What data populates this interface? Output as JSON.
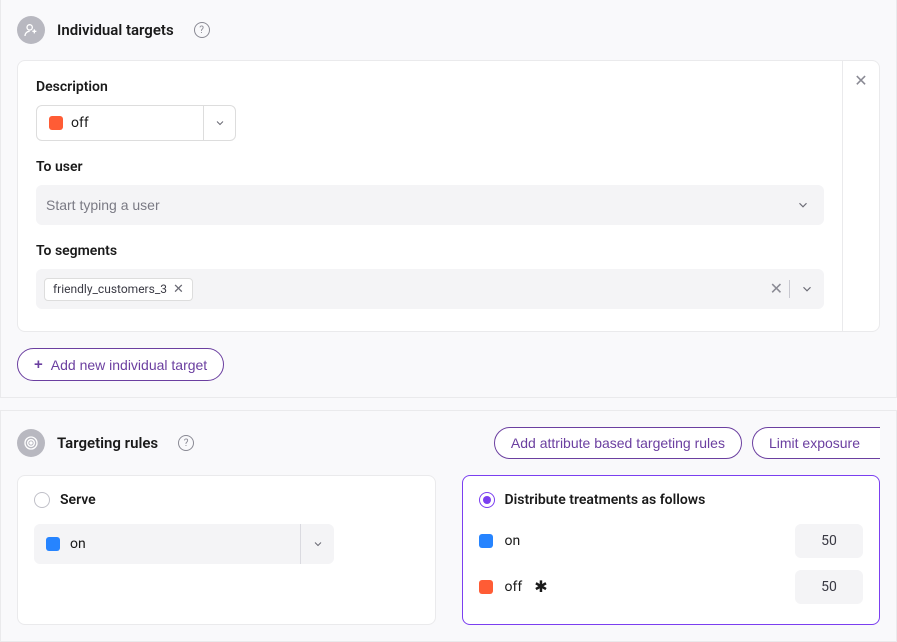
{
  "individual_targets": {
    "title": "Individual targets",
    "description_label": "Description",
    "description_value": "off",
    "to_user_label": "To user",
    "to_user_placeholder": "Start typing a user",
    "to_segments_label": "To segments",
    "segment_chip": "friendly_customers_3",
    "add_button": "Add new individual target"
  },
  "targeting_rules": {
    "title": "Targeting rules",
    "add_attr_button": "Add attribute based targeting rules",
    "limit_exposure_button": "Limit exposure",
    "serve": {
      "title": "Serve",
      "value": "on"
    },
    "distribute": {
      "title": "Distribute treatments as follows",
      "rows": [
        {
          "label": "on",
          "value": "50"
        },
        {
          "label": "off",
          "value": "50"
        }
      ]
    }
  }
}
